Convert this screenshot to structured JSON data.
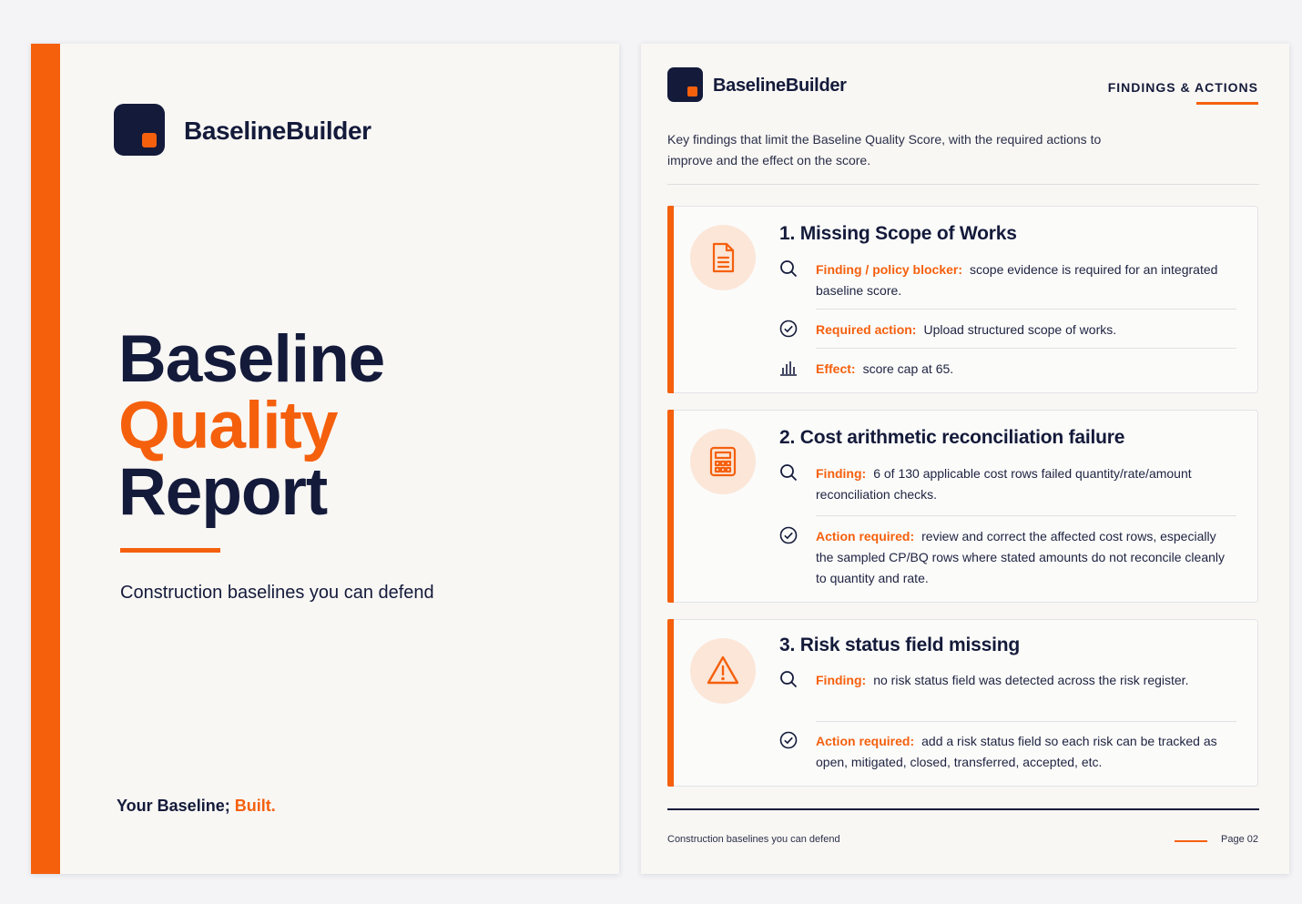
{
  "cover": {
    "brand": "BaselineBuilder",
    "title_line1": "Baseline",
    "title_line2": "Quality",
    "title_line3": "Report",
    "tagline": "Construction baselines you can defend",
    "footer_main": "Your Baseline;",
    "footer_accent": "Built."
  },
  "findings_page": {
    "brand": "BaselineBuilder",
    "section_label": "FINDINGS & ACTIONS",
    "intro": "Key findings that limit the Baseline Quality Score, with the required actions to improve and the effect on the score.",
    "findings": [
      {
        "title": "1. Missing Scope of Works",
        "icon": "document-icon",
        "rows": [
          {
            "icon": "search-icon",
            "label": "Finding / policy blocker:",
            "text": "scope evidence is required for an integrated baseline score."
          },
          {
            "icon": "check-circle-icon",
            "label": "Required action:",
            "text": "Upload structured scope of works."
          },
          {
            "icon": "bar-chart-icon",
            "label": "Effect:",
            "text": "score cap at 65."
          }
        ]
      },
      {
        "title": "2. Cost arithmetic reconciliation failure",
        "icon": "calculator-icon",
        "rows": [
          {
            "icon": "search-icon",
            "label": "Finding:",
            "text": "6 of 130 applicable cost rows failed quantity/rate/amount reconciliation checks."
          },
          {
            "icon": "check-circle-icon",
            "label": "Action required:",
            "text": "review and correct the affected cost rows, especially the sampled CP/BQ rows where stated amounts do not reconcile cleanly to quantity and rate."
          }
        ]
      },
      {
        "title": "3. Risk status field missing",
        "icon": "warning-icon",
        "rows": [
          {
            "icon": "search-icon",
            "label": "Finding:",
            "text": "no risk status field was detected across the risk register."
          },
          {
            "icon": "check-circle-icon",
            "label": "Action required:",
            "text": "add a risk status field so each risk can be tracked as open, mitigated, closed, transferred, accepted, etc."
          }
        ]
      }
    ],
    "footer_left": "Construction baselines you can defend",
    "page_label": "Page 02"
  },
  "colors": {
    "accent": "#f5600d",
    "navy": "#141a3a",
    "page": "#f8f7f4"
  }
}
